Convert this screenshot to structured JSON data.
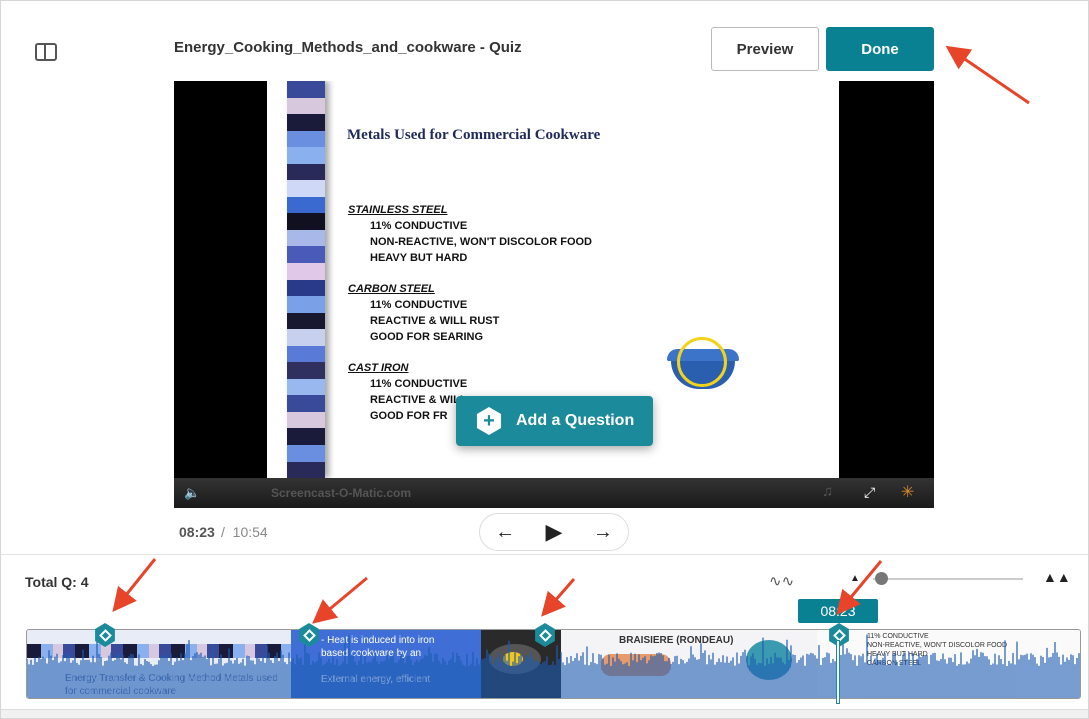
{
  "header": {
    "title": "Energy_Cooking_Methods_and_cookware - Quiz",
    "preview_label": "Preview",
    "done_label": "Done"
  },
  "video": {
    "slide_title": "Metals Used for Commercial Cookware",
    "sections": [
      {
        "heading": "STAINLESS STEEL",
        "lines": [
          "11% CONDUCTIVE",
          "NON-REACTIVE, WON'T DISCOLOR FOOD",
          "HEAVY BUT HARD"
        ]
      },
      {
        "heading": "CARBON STEEL",
        "lines": [
          "11% CONDUCTIVE",
          "REACTIVE & WILL RUST",
          "GOOD FOR SEARING"
        ]
      },
      {
        "heading": "CAST IRON",
        "lines": [
          "11% CONDUCTIVE",
          "REACTIVE & WILL",
          "GOOD FOR FR"
        ]
      }
    ],
    "watermark": "Screencast-O-Matic.com",
    "add_question_label": "Add a Question"
  },
  "player": {
    "current_time": "08:23",
    "separator": "/",
    "total_time": "10:54",
    "prev_icon": "arrow-left-icon",
    "play_icon": "play-icon",
    "next_icon": "arrow-right-icon"
  },
  "timeline": {
    "total_questions_label": "Total Q: 4",
    "playhead_time": "08:23",
    "question_markers": 4,
    "thumbnails": [
      {
        "text": "Energy Transfer & Cooking Method\nMetals used for commercial cookware"
      },
      {
        "text": "- Heat is induced into iron\nbased cookware by an\n\nExternal energy, efficient"
      },
      {
        "text": ""
      },
      {
        "text": "BRAISIERE (RONDEAU)"
      },
      {
        "text": "11% CONDUCTIVE\nNON-REACTIVE, WON'T DISCOLOR FOOD\nHEAVY BUT HARD\nCARBON STEEL"
      }
    ]
  },
  "colors": {
    "accent": "#0a8192",
    "marker": "#1b8a9a",
    "annotation_arrow": "#e8442a",
    "waveform": "#1e5db3"
  }
}
